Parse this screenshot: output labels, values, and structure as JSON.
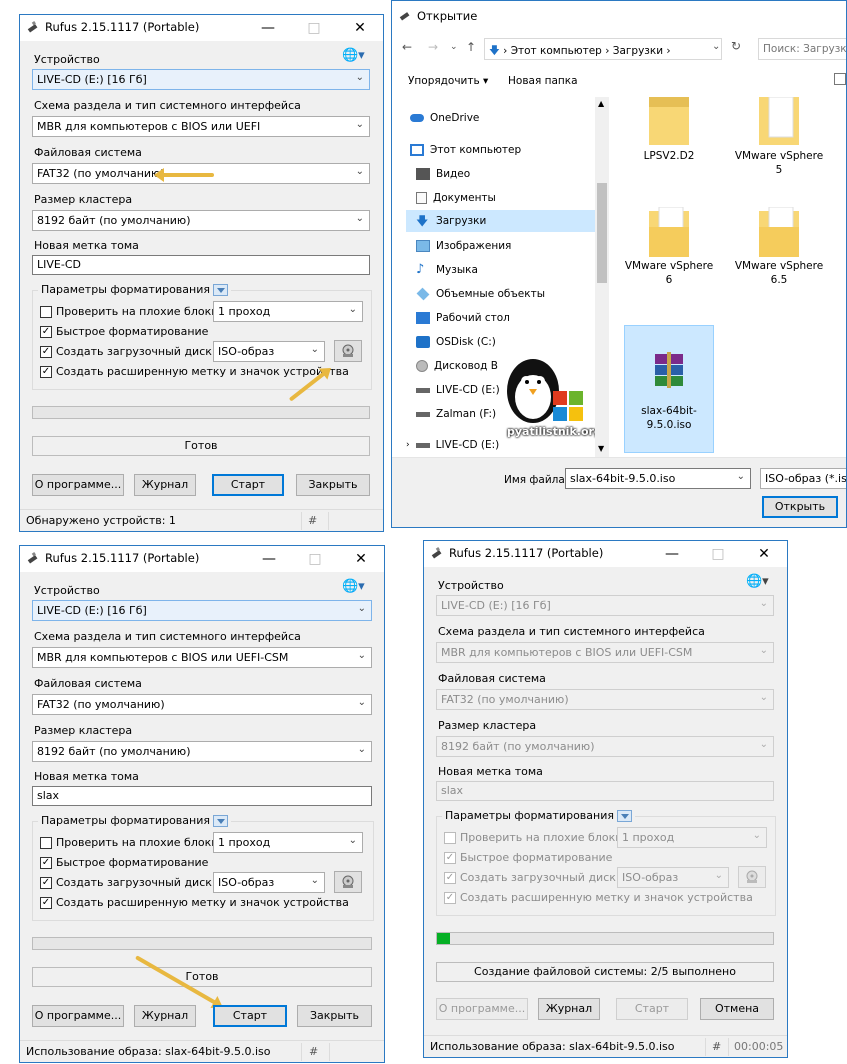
{
  "rufus1": {
    "title": "Rufus 2.15.1117 (Portable)",
    "device_label": "Устройство",
    "device_value": "LIVE-CD (E:) [16 Гб]",
    "partition_label": "Схема раздела и тип системного интерфейса",
    "partition_value": "MBR для компьютеров с BIOS или UEFI",
    "fs_label": "Файловая система",
    "fs_value": "FAT32 (по умолчанию)",
    "cluster_label": "Размер кластера",
    "cluster_value": "8192 байт (по умолчанию)",
    "volume_label": "Новая метка тома",
    "volume_value": "LIVE-CD",
    "format_group": "Параметры форматирования",
    "bad_blocks": "Проверить на плохие блоки",
    "passes": "1 проход",
    "quick_format": "Быстрое форматирование",
    "bootable": "Создать загрузочный диск",
    "image_type": "ISO-образ",
    "extended_label": "Создать расширенную метку и значок устройства",
    "status": "Готов",
    "about": "О программе...",
    "log": "Журнал",
    "start": "Старт",
    "close": "Закрыть",
    "statusbar": "Обнаружено устройств: 1",
    "hash": "#"
  },
  "rufus2": {
    "title": "Rufus 2.15.1117 (Portable)",
    "device_label": "Устройство",
    "device_value": "LIVE-CD (E:) [16 Гб]",
    "partition_label": "Схема раздела и тип системного интерфейса",
    "partition_value": "MBR для компьютеров с BIOS или UEFI-CSM",
    "fs_label": "Файловая система",
    "fs_value": "FAT32 (по умолчанию)",
    "cluster_label": "Размер кластера",
    "cluster_value": "8192 байт (по умолчанию)",
    "volume_label": "Новая метка тома",
    "volume_value": "slax",
    "format_group": "Параметры форматирования",
    "bad_blocks": "Проверить на плохие блоки",
    "passes": "1 проход",
    "quick_format": "Быстрое форматирование",
    "bootable": "Создать загрузочный диск",
    "image_type": "ISO-образ",
    "extended_label": "Создать расширенную метку и значок устройства",
    "status": "Готов",
    "about": "О программе...",
    "log": "Журнал",
    "start": "Старт",
    "close": "Закрыть",
    "statusbar": "Использование образа: slax-64bit-9.5.0.iso",
    "hash": "#"
  },
  "rufus3": {
    "title": "Rufus 2.15.1117 (Portable)",
    "device_label": "Устройство",
    "device_value": "LIVE-CD (E:) [16 Гб]",
    "partition_label": "Схема раздела и тип системного интерфейса",
    "partition_value": "MBR для компьютеров с BIOS или UEFI-CSM",
    "fs_label": "Файловая система",
    "fs_value": "FAT32 (по умолчанию)",
    "cluster_label": "Размер кластера",
    "cluster_value": "8192 байт (по умолчанию)",
    "volume_label": "Новая метка тома",
    "volume_value": "slax",
    "format_group": "Параметры форматирования",
    "bad_blocks": "Проверить на плохие блоки",
    "passes": "1 проход",
    "quick_format": "Быстрое форматирование",
    "bootable": "Создать загрузочный диск",
    "image_type": "ISO-образ",
    "extended_label": "Создать расширенную метку и значок устройства",
    "progress_fraction": 0.04,
    "status": "Создание файловой системы: 2/5 выполнено",
    "about": "О программе...",
    "log": "Журнал",
    "start": "Старт",
    "cancel": "Отмена",
    "statusbar": "Использование образа: slax-64bit-9.5.0.iso",
    "hash": "#",
    "elapsed": "00:00:05"
  },
  "explorer": {
    "title": "Открытие",
    "address_part1": "Этот компьютер",
    "address_part2": "Загрузки",
    "search_placeholder": "Поиск: Загрузки",
    "organize": "Упорядочить",
    "new_folder": "Новая папка",
    "nav_items": [
      "OneDrive",
      "Этот компьютер",
      "Видео",
      "Документы",
      "Загрузки",
      "Изображения",
      "Музыка",
      "Объемные объекты",
      "Рабочий стол",
      "OSDisk (C:)",
      "Дисковод B",
      "LIVE-CD (E:)",
      "Zalman (F:)",
      "LIVE-CD (E:)"
    ],
    "files": [
      "LPSV2.D2",
      "VMware vSphere 5",
      "VMware vSphere 6",
      "VMware vSphere 6.5",
      "slax-64bit-9.5.0.iso"
    ],
    "filename_label": "Имя файла:",
    "filename_value": "slax-64bit-9.5.0.iso",
    "filter_value": "ISO-образ (*.iso)",
    "open_button": "Открыть",
    "watermark": "pyatilistnik.org"
  },
  "colors": {
    "window_border": "#2b79c2",
    "primary_button": "#0078d7",
    "progress_fill": "#06b025",
    "selection": "#cce8ff",
    "annotation_arrow": "#e8b840"
  }
}
